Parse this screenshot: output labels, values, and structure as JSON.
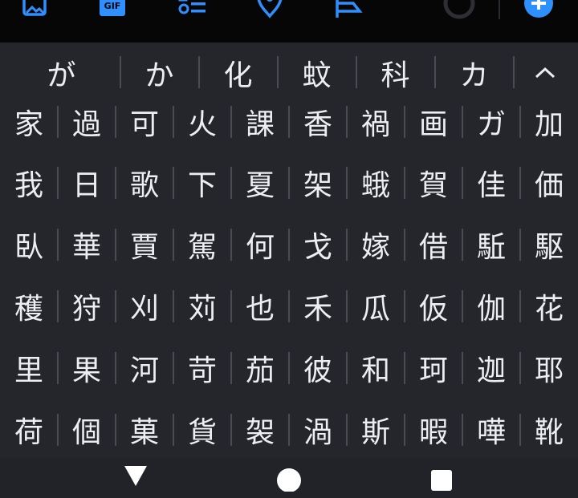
{
  "toolbar": {
    "icons": [
      "image-icon",
      "gif-icon",
      "clipboard-list-icon",
      "location-icon",
      "flag-icon",
      "circle-icon",
      "add-icon"
    ],
    "gif_label": "GIF"
  },
  "candidates": [
    "が",
    "か",
    "化",
    "蚊",
    "科",
    "カ"
  ],
  "collapse_glyph": "^",
  "grid": [
    [
      "家",
      "過",
      "可",
      "火",
      "課",
      "香",
      "禍",
      "画",
      "ガ",
      "加"
    ],
    [
      "我",
      "日",
      "歌",
      "下",
      "夏",
      "架",
      "蛾",
      "賀",
      "佳",
      "価"
    ],
    [
      "臥",
      "華",
      "賈",
      "駕",
      "何",
      "戈",
      "嫁",
      "借",
      "駈",
      "駆"
    ],
    [
      "穫",
      "狩",
      "刈",
      "苅",
      "也",
      "禾",
      "瓜",
      "仮",
      "伽",
      "花"
    ],
    [
      "里",
      "果",
      "河",
      "苛",
      "茄",
      "彼",
      "和",
      "珂",
      "迦",
      "耶"
    ],
    [
      "荷",
      "個",
      "菓",
      "貨",
      "袈",
      "渦",
      "斯",
      "暇",
      "嘩",
      "靴"
    ]
  ],
  "colors": {
    "accent": "#2f8fff",
    "keyboard_bg": "#25262c",
    "toolbar_bg": "#060606",
    "text": "#eceef2"
  }
}
